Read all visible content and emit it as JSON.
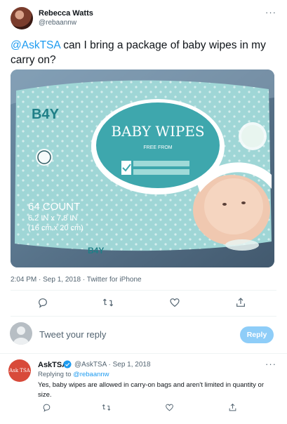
{
  "tweet": {
    "author_name": "Rebecca Watts",
    "author_handle": "@rebaannw",
    "mention": "@AskTSA",
    "text": "can I bring a package of baby wipes in my carry on?",
    "media": {
      "brand": "B4Y",
      "product": "BABY WIPES",
      "free_from": "FREE FROM",
      "count_line1": "64 COUNT",
      "count_line2": "6.2 IN x 7.8 IN",
      "count_line3": "(16 cm x 20 cm)"
    },
    "timestamp": "2:04 PM · Sep 1, 2018 · Twitter for iPhone"
  },
  "composer": {
    "placeholder": "Tweet your reply",
    "button_label": "Reply"
  },
  "reply": {
    "author_name": "AskTSA",
    "meta": "@AskTSA · Sep 1, 2018",
    "replying_prefix": "Replying to",
    "replying_handle": "@rebaannw",
    "text": "Yes, baby wipes are allowed in carry-on bags and aren't limited in quantity or size.",
    "avatar_label": "Ask TSA"
  },
  "icons": [
    "more-icon",
    "reply-icon",
    "retweet-icon",
    "like-icon",
    "share-icon",
    "verified-icon",
    "default-avatar-icon"
  ],
  "colors": {
    "link": "#1d9bf0",
    "reply_button": "#8ecdf8",
    "tsa_avatar": "#d84a3a",
    "secondary_text": "#536471"
  }
}
